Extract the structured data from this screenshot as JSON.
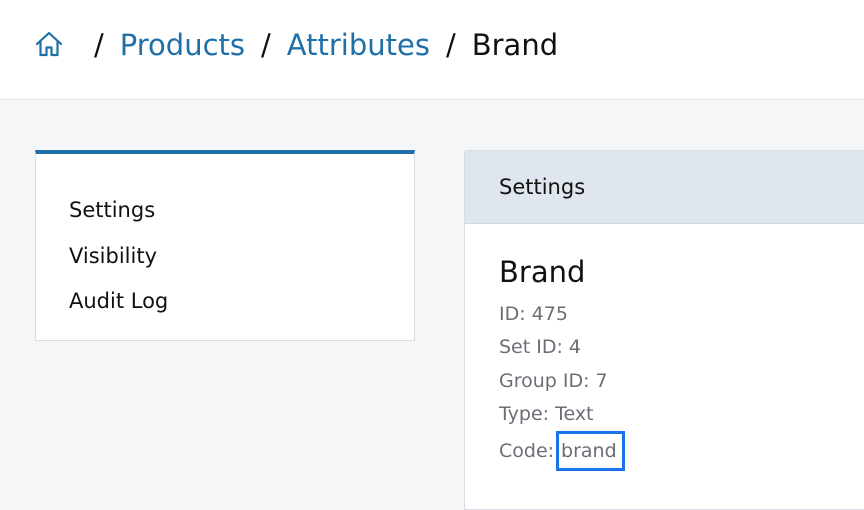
{
  "breadcrumb": {
    "home_icon": "home-icon",
    "separator": "/",
    "items": [
      {
        "label": "Products"
      },
      {
        "label": "Attributes"
      }
    ],
    "current": "Brand"
  },
  "sidebar": {
    "accent_color": "#1f70a8",
    "items": [
      {
        "label": "Settings"
      },
      {
        "label": "Visibility"
      },
      {
        "label": "Audit Log"
      }
    ]
  },
  "panel": {
    "header": "Settings",
    "title": "Brand",
    "id": "ID: 475",
    "set_id": "Set ID: 4",
    "group_id": "Group ID: 7",
    "type": "Type: Text",
    "code_label": "Code:",
    "code_value": "brand",
    "highlight_color": "#1a73e8"
  }
}
